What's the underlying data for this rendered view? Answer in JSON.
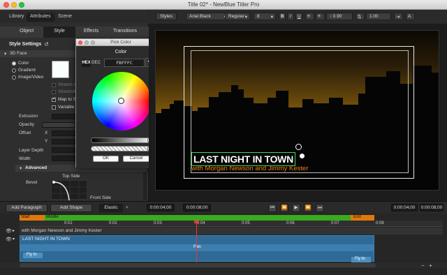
{
  "window": {
    "title": "Title 02* - NewBlue Titler Pro"
  },
  "top_tabs": [
    "Library",
    "Attributes",
    "Scene"
  ],
  "sub_tabs": [
    "Object",
    "Style",
    "Effects",
    "Transitions"
  ],
  "style_settings": {
    "heading": "Style Settings",
    "section_3d": "3D Face",
    "fill_options": [
      "Color",
      "Gradient",
      "Image/Video"
    ],
    "swatch_color": "#FBFFFC",
    "stretch_label": "Stretch to",
    "stretch_label2": "Stretch/Mo",
    "map_label": "Map to Si",
    "variable_label": "Variable",
    "extrusion": "Extrusion",
    "opacity": "Opacity",
    "offset": "Offset",
    "x": "X",
    "y": "Y",
    "layer_depth": "Layer Depth",
    "width": "Width",
    "advanced": "Advanced",
    "bevel": "Bevel",
    "top_side": "Top Side",
    "front_side": "Front Side"
  },
  "color_picker": {
    "title": "Pick Color",
    "label": "Color",
    "mode_hex": "HEX",
    "mode_dec": "DEC",
    "value": "FBFFFC",
    "ok": "OK",
    "cancel": "Cancel"
  },
  "toolbar": {
    "styles": "Styles",
    "font": "Arial Black",
    "weight": "Regular",
    "size": "8",
    "bold": "B",
    "italic": "I",
    "underline": "U",
    "line_spacing": "0.90",
    "tracking": "1.00"
  },
  "canvas": {
    "title_line": "LAST NIGHT IN TOWN",
    "subtitle_line": "with Morgan Newson and Jimmy Kester",
    "accent_color": "#F07F0F"
  },
  "bottom": {
    "add_paragraph": "Add Paragraph",
    "add_shape": "Add Shape",
    "elastic": "Elastic",
    "plus": "+",
    "tc_left_a": "0:00:04;00",
    "tc_left_b": "0:00:08;00",
    "tc_right_a": "0:00:04;00",
    "tc_right_b": "0:00:08;00"
  },
  "timeline": {
    "start": "Start",
    "middle": "Middle",
    "end": "End",
    "ticks": [
      "0:01",
      "0:02",
      "0:03",
      "0:04",
      "0:05",
      "0:06",
      "0:07",
      "0:08"
    ],
    "track1": "with Morgan Newson and Jimmy Kester",
    "track2": "LAST NIGHT IN TOWN",
    "pan": "Pan",
    "fly_in_a": "Fly In",
    "fly_in_b": "Fly In",
    "zoom_minus": "−",
    "zoom_plus": "+"
  }
}
